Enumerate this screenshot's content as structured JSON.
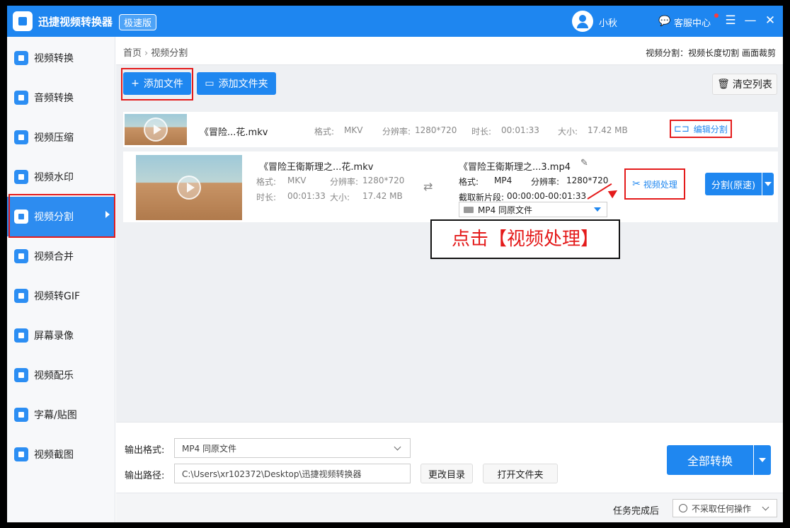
{
  "title_bar": {
    "app_title": "迅捷视频转换器",
    "edition_badge": "极速版",
    "username": "小秋",
    "service_label": "客服中心",
    "menu_icon": "☰",
    "minimize_icon": "—",
    "close_icon": "✕"
  },
  "sidebar": {
    "items": [
      {
        "label": "视频转换",
        "icon": "video-convert-icon"
      },
      {
        "label": "音频转换",
        "icon": "audio-convert-icon"
      },
      {
        "label": "视频压缩",
        "icon": "video-compress-icon"
      },
      {
        "label": "视频水印",
        "icon": "video-watermark-icon"
      },
      {
        "label": "视频分割",
        "icon": "video-split-icon"
      },
      {
        "label": "视频合并",
        "icon": "video-merge-icon"
      },
      {
        "label": "视频转GIF",
        "icon": "gif-icon"
      },
      {
        "label": "屏幕录像",
        "icon": "screen-record-icon"
      },
      {
        "label": "视频配乐",
        "icon": "music-icon"
      },
      {
        "label": "字幕/贴图",
        "icon": "subtitle-icon"
      },
      {
        "label": "视频截图",
        "icon": "screenshot-icon"
      }
    ],
    "active_index": 4
  },
  "breadcrumb": {
    "home": "首页",
    "separator": "›",
    "current": "视频分割"
  },
  "mode_info": "视频分割：视频长度切割  画面裁剪",
  "toolbar": {
    "add_file": "添加文件",
    "add_folder": "添加文件夹",
    "clear_list": "清空列表",
    "plus_icon": "+",
    "trash_icon": "🗑"
  },
  "file_rows": [
    {
      "name": "《冒险...花.mkv",
      "format_label": "格式:",
      "format": "MKV",
      "resolution_label": "分辨率:",
      "resolution": "1280*720",
      "duration_label": "时长:",
      "duration": "00:01:33",
      "size_label": "大小:",
      "size": "17.42 MB",
      "action_label": "编辑分割"
    }
  ],
  "split_item": {
    "source": {
      "name": "《冒险王衛斯理之...花.mkv",
      "format_label": "格式:",
      "format": "MKV",
      "resolution_label": "分辨率:",
      "resolution": "1280*720",
      "duration_label": "时长:",
      "duration": "00:01:33",
      "size_label": "大小:",
      "size": "17.42 MB"
    },
    "output": {
      "name": "《冒险王衛斯理之...3.mp4",
      "format_label": "格式:",
      "format": "MP4",
      "resolution_label": "分辨率:",
      "resolution": "1280*720",
      "clip_label": "截取新片段:",
      "clip": "00:00:00-00:01:33",
      "format_select": "MP4   同原文件"
    },
    "process_button": "视频处理",
    "split_button": "分割(原速)"
  },
  "callout": "点击【视频处理】",
  "bottom": {
    "format_label": "输出格式:",
    "format_value": "MP4   同原文件",
    "path_label": "输出路径:",
    "path_value": "C:\\Users\\xr102372\\Desktop\\迅捷视频转换器",
    "change_dir": "更改目录",
    "open_folder": "打开文件夹",
    "convert_all": "全部转换"
  },
  "status": {
    "after_label": "任务完成后",
    "after_value": "不采取任何操作"
  },
  "colors": {
    "accent": "#1f87f0",
    "highlight": "#e41b1b"
  }
}
